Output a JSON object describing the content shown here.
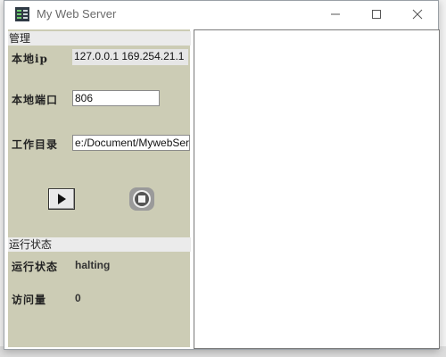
{
  "window": {
    "title": "My Web Server",
    "app_icon": "server-icon",
    "controls": {
      "minimize_icon": "minimize-icon",
      "maximize_icon": "maximize-icon",
      "close_icon": "close-icon"
    }
  },
  "management": {
    "header": "管理",
    "ip_label": "本地ip",
    "ip_value": "127.0.0.1 169.254.21.1",
    "port_label": "本地端口",
    "port_value": "806",
    "dir_label": "工作目录",
    "dir_value": "e:/Document/MywebServer",
    "start_icon": "play-icon",
    "stop_icon": "stop-icon"
  },
  "status": {
    "header": "运行状态",
    "state_label": "运行状态",
    "state_value": "halting",
    "visits_label": "访问量",
    "visits_value": "0"
  },
  "colors": {
    "panel_bg": "#ccccb5",
    "header_bg": "#ebebeb",
    "window_bg": "#ffffff"
  }
}
